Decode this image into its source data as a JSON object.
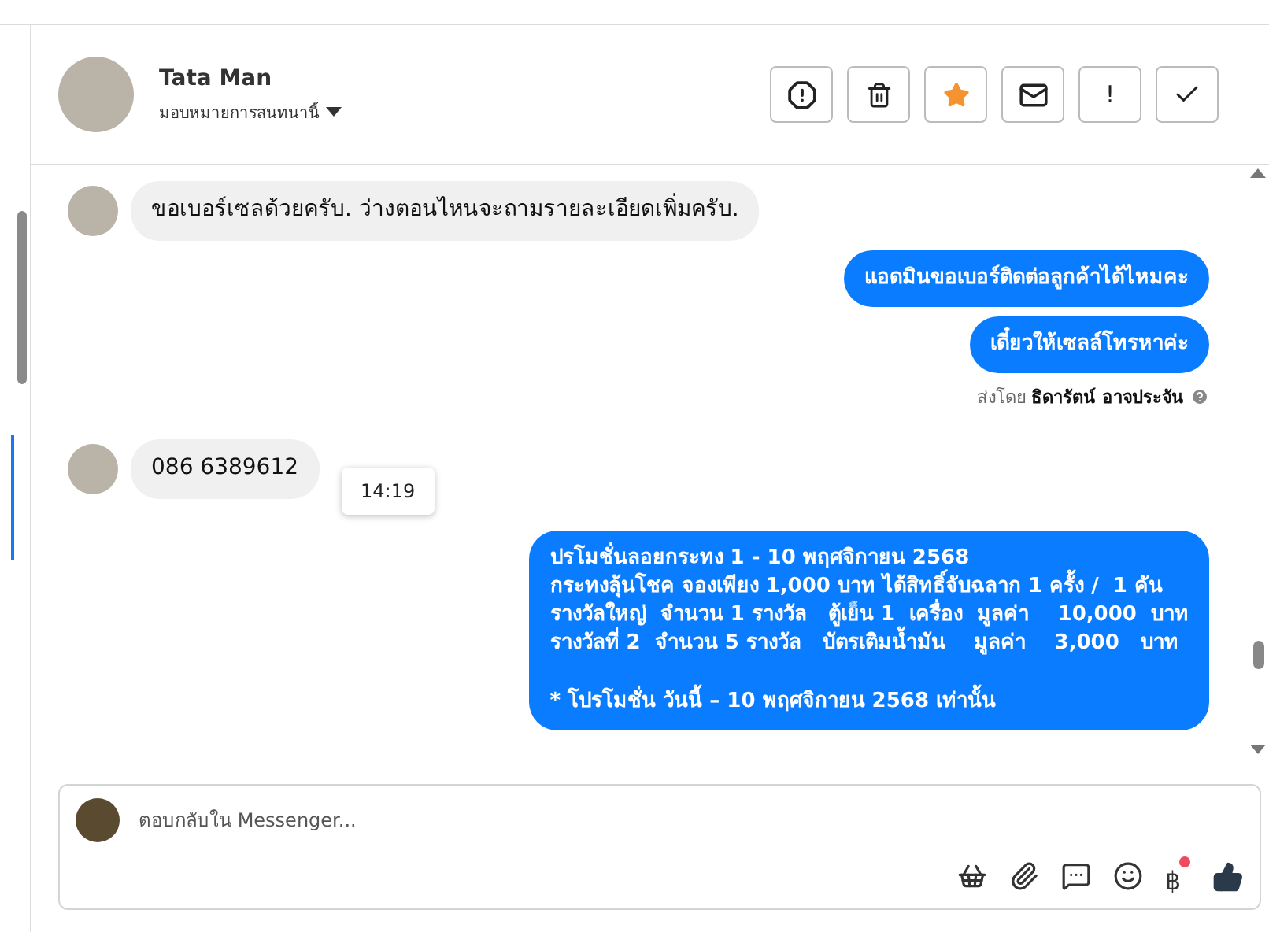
{
  "header": {
    "name": "Tata Man",
    "assign_label": "มอบหมายการสนทนานี้",
    "actions": [
      {
        "kind": "spam"
      },
      {
        "kind": "delete"
      },
      {
        "kind": "star",
        "active": true
      },
      {
        "kind": "mail"
      },
      {
        "kind": "text",
        "text": "!"
      },
      {
        "kind": "done"
      }
    ]
  },
  "messages": [
    {
      "kind": "incoming",
      "text": "ขอเบอร์เซลด้วยครับ. ว่างตอนไหนจะถามรายละเอียดเพิ่มครับ."
    },
    {
      "kind": "outgoing",
      "text": "แอดมินขอเบอร์ติดต่อลูกค้าได้ไหมคะ"
    },
    {
      "kind": "outgoing",
      "text": "เดี๋ยวให้เซลล์โทรหาค่ะ"
    },
    {
      "kind": "note",
      "text": "ส่งโดย **ธิดารัตน์ อาจประจัน**"
    },
    {
      "kind": "incoming",
      "text": "086 6389612"
    },
    {
      "kind": "outgoing",
      "tooltip": "14:19",
      "text": "ปรโมชั่นลอยกระทง 1 - 10 พฤศจิกายน 2568\nกระทงลุ้นโชค จองเพียง 1,000 บาท ได้สิทธิ์จับฉลาก 1 ครั้ง /  1 คัน\nรางวัลใหญ่  จำนวน 1 รางวัล   ตู้เย็น 1  เครื่อง  มูลค่า    10,000  บาท\nรางวัลที่ 2  จำนวน 5 รางวัล   บัตรเติมน้ำมัน    มูลค่า    3,000   บาท\n\n* โปรโมชั่น วันนี้ – 10 พฤศจิกายน 2568 เท่านั้น"
    }
  ],
  "composer": {
    "placeholder": "ตอบกลับใน Messenger...",
    "currency_symbol": "฿",
    "currency_notification": true
  }
}
